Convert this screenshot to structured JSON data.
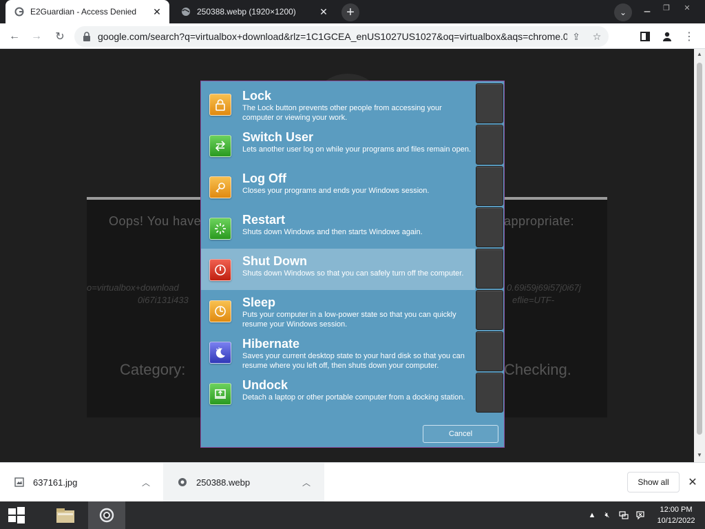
{
  "browser": {
    "tabs": [
      {
        "title": "E2Guardian - Access Denied",
        "active": true,
        "favicon": "google-g-icon"
      },
      {
        "title": "250388.webp (1920×1200)",
        "active": false,
        "favicon": "globe-icon"
      }
    ],
    "url": "google.com/search?q=virtualbox+download&rlz=1C1GCEA_enUS1027US1027&oq=virtualbox&aqs=chrome.0.6..."
  },
  "page": {
    "message_left": "Oops! You have",
    "message_right": "appropriate:",
    "url_fragment_left_1": "o=virtualbox+download",
    "url_fragment_left_2": "0i67i131i433",
    "url_fragment_right_1": "0.69i59j69i57j0i67j",
    "url_fragment_right_2": "eflie=UTF-",
    "category_label": "Category:",
    "category_right": "Checking."
  },
  "shutdown_menu": {
    "items": [
      {
        "name": "Lock",
        "desc": "The Lock button prevents other people from accessing your computer or viewing your work.",
        "icon": "lock-icon",
        "color": "#f0a020"
      },
      {
        "name": "Switch User",
        "desc": "Lets another user log on while your programs and files remain open.",
        "icon": "switch-user-icon",
        "color": "#3cae2e"
      },
      {
        "name": "Log Off",
        "desc": "Closes your programs and ends your Windows session.",
        "icon": "key-icon",
        "color": "#f0a020"
      },
      {
        "name": "Restart",
        "desc": "Shuts down Windows and then starts Windows again.",
        "icon": "restart-icon",
        "color": "#3cae2e"
      },
      {
        "name": "Shut Down",
        "desc": "Shuts down Windows so that you can safely turn off the computer.",
        "icon": "power-icon",
        "color": "#d93a2a"
      },
      {
        "name": "Sleep",
        "desc": "Puts your computer in a low-power state so that you can quickly resume your Windows session.",
        "icon": "sleep-icon",
        "color": "#f0a020"
      },
      {
        "name": "Hibernate",
        "desc": "Saves your current desktop state to your hard disk so that you can resume where you left off, then shuts down your computer.",
        "icon": "moon-icon",
        "color": "#4a52d0"
      },
      {
        "name": "Undock",
        "desc": "Detach a laptop or other portable computer from a docking station.",
        "icon": "undock-icon",
        "color": "#3cae2e"
      }
    ],
    "selected_index": 4,
    "cancel_label": "Cancel"
  },
  "downloads": {
    "items": [
      {
        "filename": "637161.jpg",
        "icon": "image-file-icon"
      },
      {
        "filename": "250388.webp",
        "icon": "chrome-file-icon"
      }
    ],
    "show_all_label": "Show all"
  },
  "taskbar": {
    "time": "12:00 PM",
    "date": "10/12/2022"
  }
}
